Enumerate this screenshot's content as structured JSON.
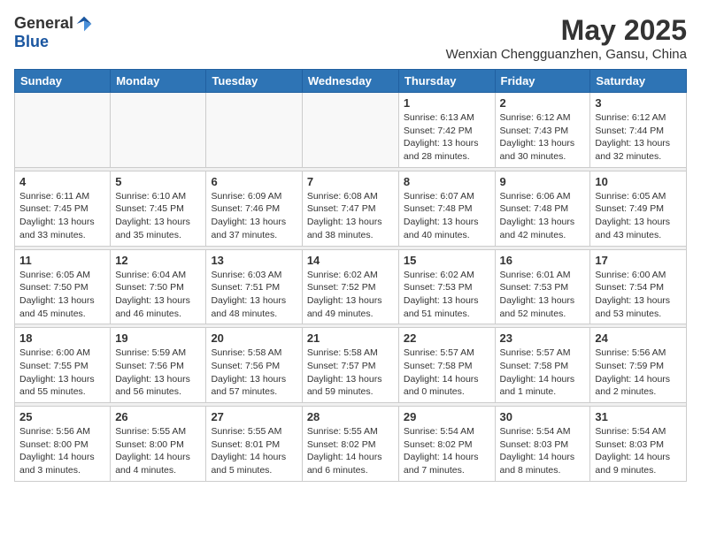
{
  "header": {
    "logo_general": "General",
    "logo_blue": "Blue",
    "month_title": "May 2025",
    "location": "Wenxian Chengguanzhen, Gansu, China"
  },
  "days_of_week": [
    "Sunday",
    "Monday",
    "Tuesday",
    "Wednesday",
    "Thursday",
    "Friday",
    "Saturday"
  ],
  "weeks": [
    [
      {
        "day": "",
        "info": ""
      },
      {
        "day": "",
        "info": ""
      },
      {
        "day": "",
        "info": ""
      },
      {
        "day": "",
        "info": ""
      },
      {
        "day": "1",
        "info": "Sunrise: 6:13 AM\nSunset: 7:42 PM\nDaylight: 13 hours\nand 28 minutes."
      },
      {
        "day": "2",
        "info": "Sunrise: 6:12 AM\nSunset: 7:43 PM\nDaylight: 13 hours\nand 30 minutes."
      },
      {
        "day": "3",
        "info": "Sunrise: 6:12 AM\nSunset: 7:44 PM\nDaylight: 13 hours\nand 32 minutes."
      }
    ],
    [
      {
        "day": "4",
        "info": "Sunrise: 6:11 AM\nSunset: 7:45 PM\nDaylight: 13 hours\nand 33 minutes."
      },
      {
        "day": "5",
        "info": "Sunrise: 6:10 AM\nSunset: 7:45 PM\nDaylight: 13 hours\nand 35 minutes."
      },
      {
        "day": "6",
        "info": "Sunrise: 6:09 AM\nSunset: 7:46 PM\nDaylight: 13 hours\nand 37 minutes."
      },
      {
        "day": "7",
        "info": "Sunrise: 6:08 AM\nSunset: 7:47 PM\nDaylight: 13 hours\nand 38 minutes."
      },
      {
        "day": "8",
        "info": "Sunrise: 6:07 AM\nSunset: 7:48 PM\nDaylight: 13 hours\nand 40 minutes."
      },
      {
        "day": "9",
        "info": "Sunrise: 6:06 AM\nSunset: 7:48 PM\nDaylight: 13 hours\nand 42 minutes."
      },
      {
        "day": "10",
        "info": "Sunrise: 6:05 AM\nSunset: 7:49 PM\nDaylight: 13 hours\nand 43 minutes."
      }
    ],
    [
      {
        "day": "11",
        "info": "Sunrise: 6:05 AM\nSunset: 7:50 PM\nDaylight: 13 hours\nand 45 minutes."
      },
      {
        "day": "12",
        "info": "Sunrise: 6:04 AM\nSunset: 7:50 PM\nDaylight: 13 hours\nand 46 minutes."
      },
      {
        "day": "13",
        "info": "Sunrise: 6:03 AM\nSunset: 7:51 PM\nDaylight: 13 hours\nand 48 minutes."
      },
      {
        "day": "14",
        "info": "Sunrise: 6:02 AM\nSunset: 7:52 PM\nDaylight: 13 hours\nand 49 minutes."
      },
      {
        "day": "15",
        "info": "Sunrise: 6:02 AM\nSunset: 7:53 PM\nDaylight: 13 hours\nand 51 minutes."
      },
      {
        "day": "16",
        "info": "Sunrise: 6:01 AM\nSunset: 7:53 PM\nDaylight: 13 hours\nand 52 minutes."
      },
      {
        "day": "17",
        "info": "Sunrise: 6:00 AM\nSunset: 7:54 PM\nDaylight: 13 hours\nand 53 minutes."
      }
    ],
    [
      {
        "day": "18",
        "info": "Sunrise: 6:00 AM\nSunset: 7:55 PM\nDaylight: 13 hours\nand 55 minutes."
      },
      {
        "day": "19",
        "info": "Sunrise: 5:59 AM\nSunset: 7:56 PM\nDaylight: 13 hours\nand 56 minutes."
      },
      {
        "day": "20",
        "info": "Sunrise: 5:58 AM\nSunset: 7:56 PM\nDaylight: 13 hours\nand 57 minutes."
      },
      {
        "day": "21",
        "info": "Sunrise: 5:58 AM\nSunset: 7:57 PM\nDaylight: 13 hours\nand 59 minutes."
      },
      {
        "day": "22",
        "info": "Sunrise: 5:57 AM\nSunset: 7:58 PM\nDaylight: 14 hours\nand 0 minutes."
      },
      {
        "day": "23",
        "info": "Sunrise: 5:57 AM\nSunset: 7:58 PM\nDaylight: 14 hours\nand 1 minute."
      },
      {
        "day": "24",
        "info": "Sunrise: 5:56 AM\nSunset: 7:59 PM\nDaylight: 14 hours\nand 2 minutes."
      }
    ],
    [
      {
        "day": "25",
        "info": "Sunrise: 5:56 AM\nSunset: 8:00 PM\nDaylight: 14 hours\nand 3 minutes."
      },
      {
        "day": "26",
        "info": "Sunrise: 5:55 AM\nSunset: 8:00 PM\nDaylight: 14 hours\nand 4 minutes."
      },
      {
        "day": "27",
        "info": "Sunrise: 5:55 AM\nSunset: 8:01 PM\nDaylight: 14 hours\nand 5 minutes."
      },
      {
        "day": "28",
        "info": "Sunrise: 5:55 AM\nSunset: 8:02 PM\nDaylight: 14 hours\nand 6 minutes."
      },
      {
        "day": "29",
        "info": "Sunrise: 5:54 AM\nSunset: 8:02 PM\nDaylight: 14 hours\nand 7 minutes."
      },
      {
        "day": "30",
        "info": "Sunrise: 5:54 AM\nSunset: 8:03 PM\nDaylight: 14 hours\nand 8 minutes."
      },
      {
        "day": "31",
        "info": "Sunrise: 5:54 AM\nSunset: 8:03 PM\nDaylight: 14 hours\nand 9 minutes."
      }
    ]
  ]
}
